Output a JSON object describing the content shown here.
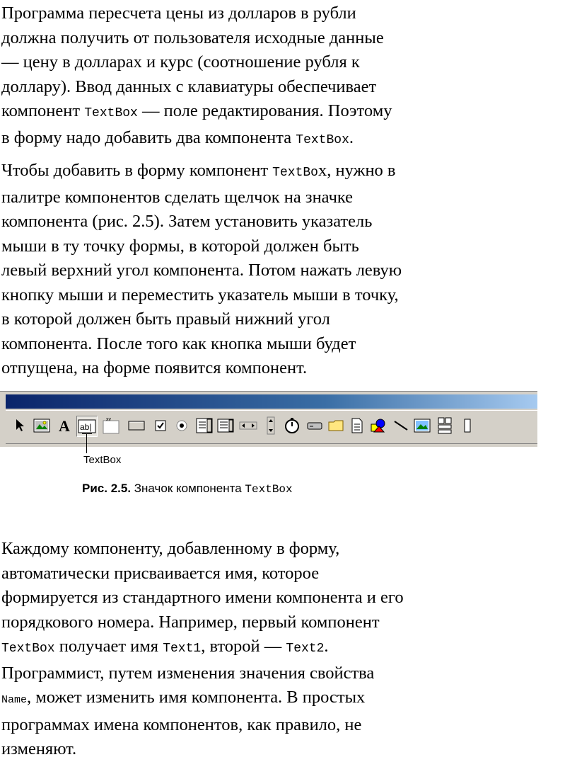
{
  "paragraph1": {
    "line1": "Программа  пересчета  цены  из  долларов  в  рубли",
    "line2": "должна получить от пользователя исходные данные",
    "line3": "— цену в долларах и курс (соотношение рубля  к",
    "line4": "доллару). Ввод данных с клавиатуры обеспечивает",
    "line5_a": "компонент ",
    "line5_code": "TextBox",
    "line5_b": " — поле редактирования. Поэтому",
    "line6_a": "в форму надо добавить два компонента ",
    "line6_code": "TextBox",
    "line6_b": "."
  },
  "paragraph2": {
    "line1_a": "Чтобы добавить в форму компонент ",
    "line1_code": "TextBo",
    "line1_b": "x, нужно в",
    "line2": "палитре  компонентов  сделать  щелчок  на  значке",
    "line3": "компонента (рис. 2.5). Затем установить указатель",
    "line4": "мыши в ту точку формы, в которой должен быть",
    "line5": "левый верхний угол компонента. Потом нажать левую",
    "line6": "кнопку мыши и переместить указатель мыши  в точку,",
    "line7": "в  которой  должен  быть  правый  нижний  угол",
    "line8": "компонента. После того как кнопка мыши будет",
    "line9": "отпущена, на форме появится компонент."
  },
  "figure": {
    "callout_label": "TextBox",
    "caption_number": "Рис. 2.5.",
    "caption_text": " Значок компонента ",
    "caption_code": "TextBox",
    "palette_icons": [
      "pointer-icon",
      "picturebox-icon",
      "label-icon",
      "textbox-icon",
      "frame-icon",
      "commandbutton-icon",
      "checkbox-icon",
      "optionbutton-icon",
      "combobox-icon",
      "listbox-icon",
      "hscrollbar-icon",
      "vscrollbar-icon",
      "timer-icon",
      "drivelistbox-icon",
      "dirlistbox-icon",
      "filelistbox-icon",
      "shape-icon",
      "line-icon",
      "image-icon",
      "data-icon",
      "ole-icon"
    ]
  },
  "paragraph3": {
    "line1": "Каждому  компоненту,  добавленному  в  форму,",
    "line2": "автоматически       присваивается       имя,       которое",
    "line3": "формируется из стандартного имени компонента и его",
    "line4": "порядкового номера. Например, первый компонент",
    "line5_code1": "TextBox",
    "line5_a": "  получает  имя  ",
    "line5_code2": "Text1",
    "line5_b": ",  второй  —  ",
    "line5_code3": "Text2",
    "line5_c": ".",
    "line6": "Программист, путем изменения значения свойства",
    "line7_code": "Name",
    "line7_b": ", может изменить имя компонента. В простых",
    "line8": "программах имена компонентов, как правило, не",
    "line9": "изменяют."
  }
}
